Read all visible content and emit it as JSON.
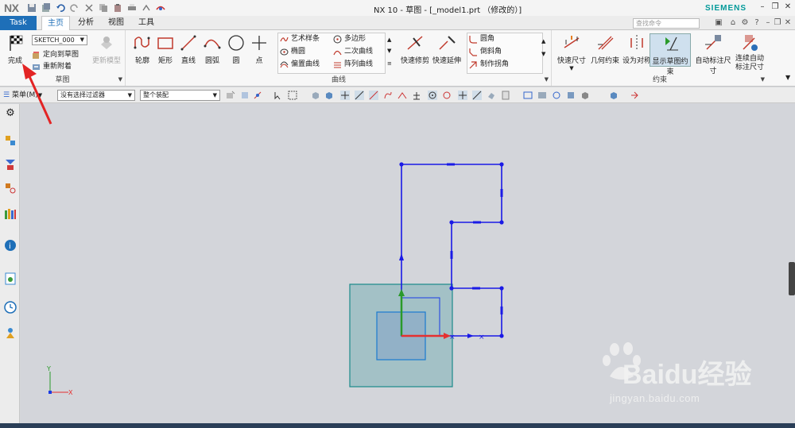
{
  "titlebar": {
    "logo": "NX",
    "title": "NX 10 - 草图 - [_model1.prt （修改的）]",
    "brand": "SIEMENS"
  },
  "tabs": {
    "task": "Task",
    "home": "主页",
    "analysis": "分析",
    "view": "视图",
    "tools": "工具"
  },
  "search": {
    "placeholder": "查找命令"
  },
  "ribbon": {
    "finish": "完成",
    "sketch_select": "SKETCH_000",
    "reorient": "定向到草图",
    "reattach": "重新附着",
    "update_model": "更新模型",
    "group_sketch": "草图",
    "profile": "轮廓",
    "rectangle": "矩形",
    "line": "直线",
    "arc": "圆弧",
    "circle": "圆",
    "point": "点",
    "studio_spline": "艺术样条",
    "polygon": "多边形",
    "ellipse": "椭圆",
    "conic": "二次曲线",
    "offset_curve": "偏置曲线",
    "pattern_curve": "阵列曲线",
    "quick_trim": "快速修剪",
    "quick_extend": "快速延伸",
    "fillet": "圆角",
    "chamfer": "倒斜角",
    "make_corner": "制作拐角",
    "group_curve": "曲线",
    "rapid_dim": "快速尺寸",
    "geo_constraints": "几何约束",
    "make_symmetric": "设为对称",
    "show_constraints": "显示草图约束",
    "auto_dim": "自动标注尺寸",
    "continuous_dim_line1": "连续自动",
    "continuous_dim_line2": "标注尺寸",
    "group_constraint": "约束"
  },
  "toolbar2": {
    "menu": "菜单(M)",
    "filter": "没有选择过滤器",
    "assembly": "整个装配"
  },
  "watermark": {
    "brand": "Baidu经验",
    "url": "jingyan.baidu.com"
  },
  "colors": {
    "accent": "#1e6fb8",
    "sketch": "#1a1ae6",
    "plane_fill": "#7fb2b8",
    "plane_edge": "#1a8a8a",
    "arrow_red": "#e53030",
    "arrow_green": "#2a9a2a"
  }
}
